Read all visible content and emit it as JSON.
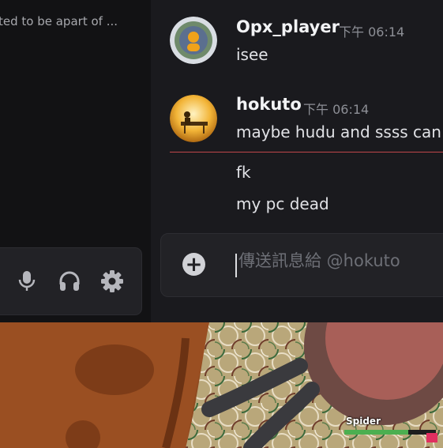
{
  "left_panel": {
    "channel_snippet": "ted to be apart of ...",
    "icons": [
      "microphone-icon",
      "headphones-icon",
      "settings-gear-icon"
    ]
  },
  "messages": [
    {
      "author": "Opx_player",
      "time": "下午 06:14",
      "lines": [
        "isee"
      ],
      "avatar": "avatar-opx-player"
    },
    {
      "author": "hokuto",
      "time": "下午 06:14",
      "lines": [
        "maybe hudu and ssss can"
      ],
      "avatar": "avatar-hokuto"
    },
    {
      "lines": [
        "fk",
        "my pc dead"
      ]
    }
  ],
  "composer": {
    "placeholder": "傳送訊息給 @hokuto",
    "value": ""
  },
  "game": {
    "enemy_label": "Spider",
    "health": 0.7
  },
  "colors": {
    "background": "#1a1a1e",
    "sidebar": "#121214",
    "new_message_divider": "#c0474b",
    "health_bar": "#4caf50"
  }
}
